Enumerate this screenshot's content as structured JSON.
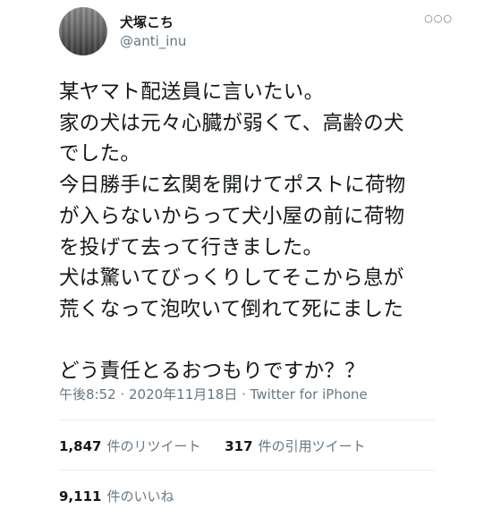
{
  "user": {
    "display_name": "犬塚こち",
    "handle": "@anti_inu",
    "more_icon": "more-horizontal-icon"
  },
  "tweet": {
    "lines": [
      "某ヤマト配送員に言いたい。",
      "家の犬は元々心臓が弱くて、高齢の犬",
      "でした。",
      "今日勝手に玄関を開けてポストに荷物",
      "が入らないからって犬小屋の前に荷物",
      "を投げて去って行きました。",
      "犬は驚いてびっくりしてそこから息が",
      "荒くなって泡吹いて倒れて死にました",
      "",
      "どう責任とるおつもりですか？？"
    ]
  },
  "meta": {
    "time": "午後8:52",
    "separator": " · ",
    "date": "2020年11月18日",
    "source": "Twitter for iPhone"
  },
  "stats": {
    "retweets_count": "1,847",
    "retweets_label": "件のリツイート",
    "quotes_count": "317",
    "quotes_label": "件の引用ツイート",
    "likes_count": "9,111",
    "likes_label": "件のいいね"
  }
}
